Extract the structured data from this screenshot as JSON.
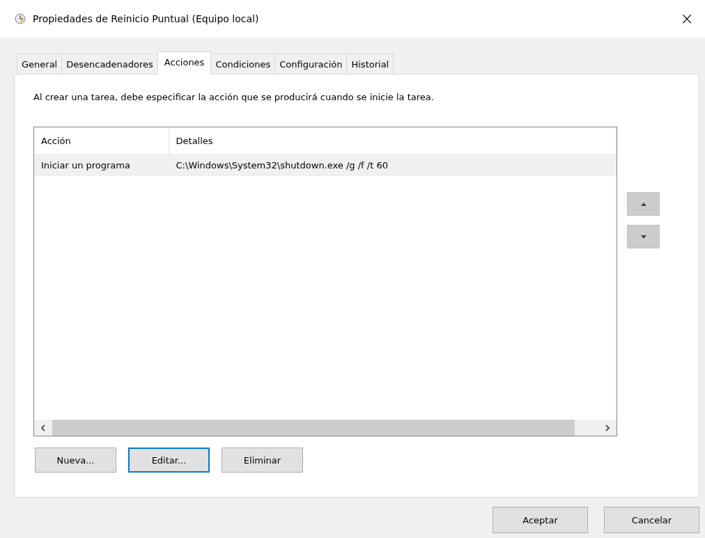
{
  "window": {
    "title": "Propiedades de Reinicio Puntual (Equipo local)",
    "close": "×"
  },
  "tabs": [
    {
      "label": "General",
      "selected": false
    },
    {
      "label": "Desencadenadores",
      "selected": false
    },
    {
      "label": "Acciones",
      "selected": true
    },
    {
      "label": "Condiciones",
      "selected": false
    },
    {
      "label": "Configuración",
      "selected": false
    },
    {
      "label": "Historial",
      "selected": false
    }
  ],
  "description": "Al crear una tarea, debe especificar la acción que se producirá cuando se inicie la tarea.",
  "table": {
    "columns": [
      "Acción",
      "Detalles"
    ],
    "rows": [
      {
        "cells": [
          "Iniciar un programa",
          "C:\\Windows\\System32\\shutdown.exe /g /f /t 60"
        ],
        "selected": true
      }
    ]
  },
  "action_buttons": [
    {
      "label": "Nueva...",
      "focused": false
    },
    {
      "label": "Editar...",
      "focused": true
    },
    {
      "label": "Eliminar",
      "focused": false
    }
  ],
  "dialog_buttons": [
    {
      "label": "Aceptar"
    },
    {
      "label": "Cancelar"
    }
  ]
}
